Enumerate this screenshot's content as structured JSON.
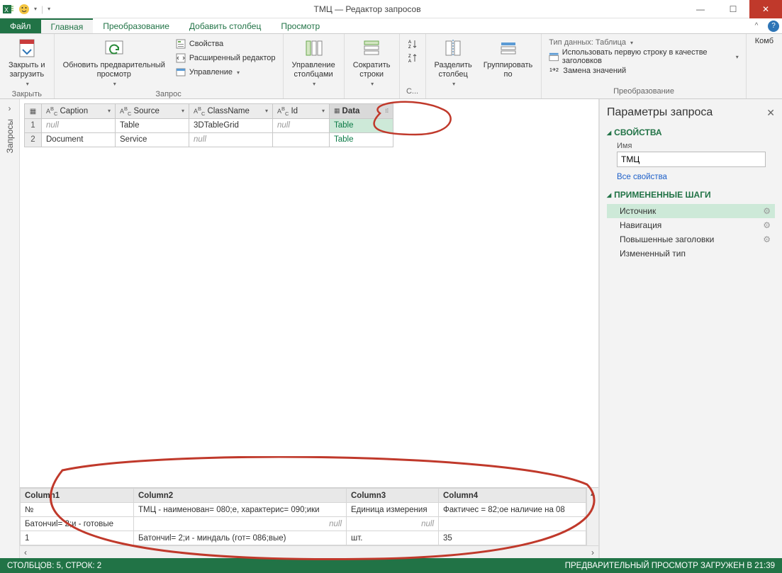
{
  "window": {
    "title": "ТМЦ — Редактор запросов"
  },
  "tabs": {
    "file": "Файл",
    "home": "Главная",
    "transform": "Преобразование",
    "addcol": "Добавить столбец",
    "view": "Просмотр"
  },
  "ribbon": {
    "close_group": "Закрыть",
    "close_load": "Закрыть и\nзагрузить",
    "query_group": "Запрос",
    "refresh": "Обновить предварительный\nпросмотр",
    "properties": "Свойства",
    "adv_editor": "Расширенный редактор",
    "manage": "Управление",
    "manage_cols": "Управление\nстолбцами",
    "reduce_rows": "Сократить\nстроки",
    "sort_group": "С...",
    "split_col": "Разделить\nстолбец",
    "group_by": "Группировать\nпо",
    "transform_group": "Преобразование",
    "datatype": "Тип данных: Таблица",
    "first_row_headers": "Использовать первую строку в качестве заголовков",
    "replace_values": "Замена значений",
    "combine": "Комб"
  },
  "sidebar": {
    "label": "Запросы"
  },
  "grid": {
    "columns": [
      "Caption",
      "Source",
      "ClassName",
      "Id",
      "Data"
    ],
    "rows": [
      {
        "caption_null": "null",
        "source": "Table",
        "classname": "3DTableGrid",
        "id_null": "null",
        "data": "Table"
      },
      {
        "caption": "Document",
        "source": "Service",
        "classname_null": "null",
        "id_blank": "",
        "data": "Table"
      }
    ]
  },
  "preview": {
    "columns": [
      "Column1",
      "Column2",
      "Column3",
      "Column4"
    ],
    "rows": [
      [
        "№",
        "ТМЦ - наименован= 080;е, характерис= 090;ики",
        "Единица измерения",
        "Фактичес = 82;ое наличие на 08"
      ],
      [
        "Батончиl= 2;и - готовые",
        "null",
        "null",
        ""
      ],
      [
        "1",
        "Батончиl= 2;и - миндаль  (гот= 086;вые)",
        "шт.",
        "35"
      ]
    ]
  },
  "panel": {
    "title": "Параметры запроса",
    "props": "СВОЙСТВА",
    "name_label": "Имя",
    "name_value": "ТМЦ",
    "all_props": "Все свойства",
    "steps_header": "ПРИМЕНЕННЫЕ ШАГИ",
    "steps": [
      "Источник",
      "Навигация",
      "Повышенные заголовки",
      "Измененный тип"
    ]
  },
  "status": {
    "left": "СТОЛБЦОВ: 5, СТРОК: 2",
    "right": "ПРЕДВАРИТЕЛЬНЫЙ ПРОСМОТР ЗАГРУЖЕН В 21:39"
  }
}
